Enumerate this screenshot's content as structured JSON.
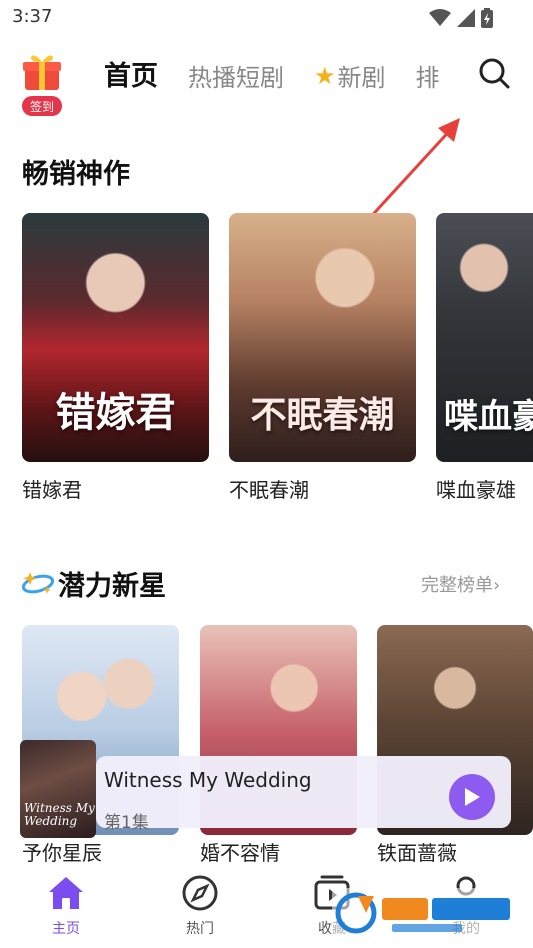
{
  "status_bar": {
    "time": "3:37",
    "icons": [
      "wifi-icon",
      "signal-icon",
      "battery-icon"
    ]
  },
  "header": {
    "gift_icon": "gift-icon",
    "signin_label": "签到",
    "tabs": [
      {
        "label": "首页",
        "active": true
      },
      {
        "label": "热播短剧",
        "active": false
      },
      {
        "label": "新剧",
        "active": false,
        "icon": "star-icon"
      },
      {
        "label": "排",
        "active": false
      }
    ],
    "search_icon": "search-icon"
  },
  "bestseller": {
    "title": "畅销神作",
    "items": [
      {
        "label": "错嫁君",
        "poster_text": "错嫁君"
      },
      {
        "label": "不眠春潮",
        "poster_text": "不眠春潮"
      },
      {
        "label": "喋血豪雄",
        "poster_text": "喋血豪"
      }
    ]
  },
  "rising": {
    "title": "潜力新星",
    "more_link": "完整榜单›",
    "items": [
      {
        "label": "予你星辰"
      },
      {
        "label": "婚不容情"
      },
      {
        "label": "铁面蔷薇"
      }
    ]
  },
  "mini_player": {
    "title": "Witness My Wedding",
    "episode": "第1集",
    "thumb_text": "Witness My Wedding"
  },
  "bottom_nav": [
    {
      "label": "主页",
      "icon": "home-icon",
      "active": true
    },
    {
      "label": "热门",
      "icon": "compass-icon",
      "active": false
    },
    {
      "label": "收藏",
      "icon": "play-box-icon",
      "active": false
    },
    {
      "label": "我的",
      "icon": "profile-icon",
      "active": false
    }
  ],
  "colors": {
    "accent": "#7b4cf0",
    "play": "#8e5bf0",
    "badge": "#e5354a",
    "arrow": "#e8413c"
  }
}
